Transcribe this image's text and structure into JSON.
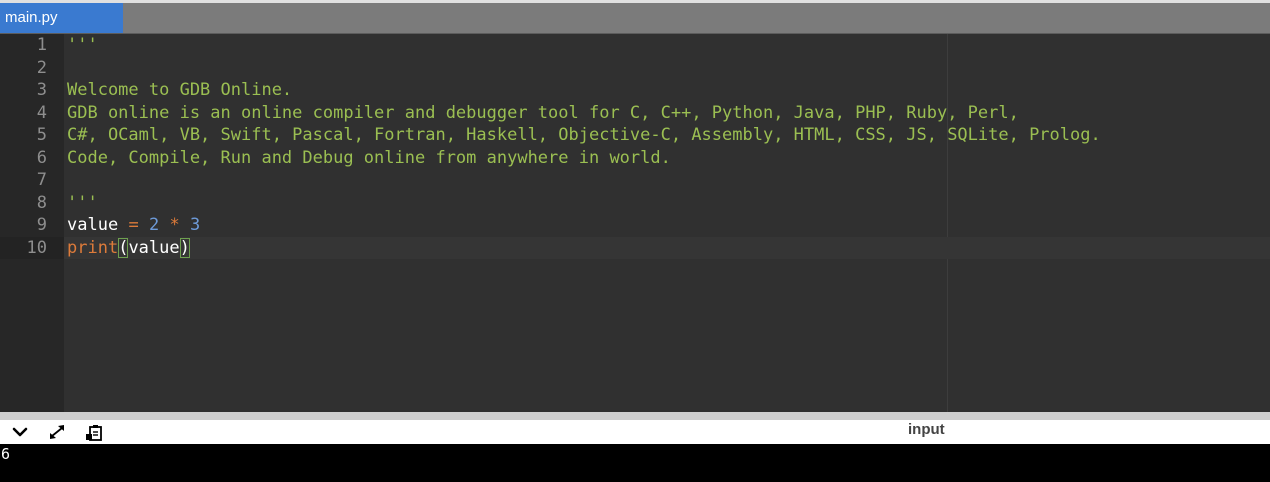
{
  "tabs": [
    {
      "label": "main.py",
      "active": true
    }
  ],
  "editor": {
    "lines": [
      {
        "num": "1",
        "parts": [
          {
            "t": "str",
            "v": "'''"
          }
        ]
      },
      {
        "num": "2",
        "parts": []
      },
      {
        "num": "3",
        "parts": [
          {
            "t": "str",
            "v": "Welcome to GDB Online."
          }
        ]
      },
      {
        "num": "4",
        "parts": [
          {
            "t": "str",
            "v": "GDB online is an online compiler and debugger tool for C, C++, Python, Java, PHP, Ruby, Perl,"
          }
        ]
      },
      {
        "num": "5",
        "parts": [
          {
            "t": "str",
            "v": "C#, OCaml, VB, Swift, Pascal, Fortran, Haskell, Objective-C, Assembly, HTML, CSS, JS, SQLite, Prolog."
          }
        ]
      },
      {
        "num": "6",
        "parts": [
          {
            "t": "str",
            "v": "Code, Compile, Run and Debug online from anywhere in world."
          }
        ]
      },
      {
        "num": "7",
        "parts": []
      },
      {
        "num": "8",
        "parts": [
          {
            "t": "str",
            "v": "'''"
          }
        ]
      },
      {
        "num": "9",
        "parts": [
          {
            "t": "ident",
            "v": "value"
          },
          {
            "t": "ws",
            "v": " "
          },
          {
            "t": "op",
            "v": "="
          },
          {
            "t": "ws",
            "v": " "
          },
          {
            "t": "num",
            "v": "2"
          },
          {
            "t": "ws",
            "v": " "
          },
          {
            "t": "op",
            "v": "*"
          },
          {
            "t": "ws",
            "v": " "
          },
          {
            "t": "num",
            "v": "3"
          }
        ]
      },
      {
        "num": "10",
        "parts": [
          {
            "t": "fn",
            "v": "print"
          },
          {
            "t": "paren",
            "v": "("
          },
          {
            "t": "ident",
            "v": "value"
          },
          {
            "t": "paren",
            "v": ")"
          }
        ],
        "active": true
      }
    ]
  },
  "output_toolbar": {
    "icons": [
      "chevron-down-icon",
      "expand-icon",
      "clipboard-icon"
    ],
    "input_label": "input"
  },
  "terminal": {
    "output": "6"
  },
  "colors": {
    "tab_active": "#3a7ad0",
    "string": "#9bbf52",
    "keyword": "#dd7b3a",
    "number": "#6d9ad8"
  }
}
